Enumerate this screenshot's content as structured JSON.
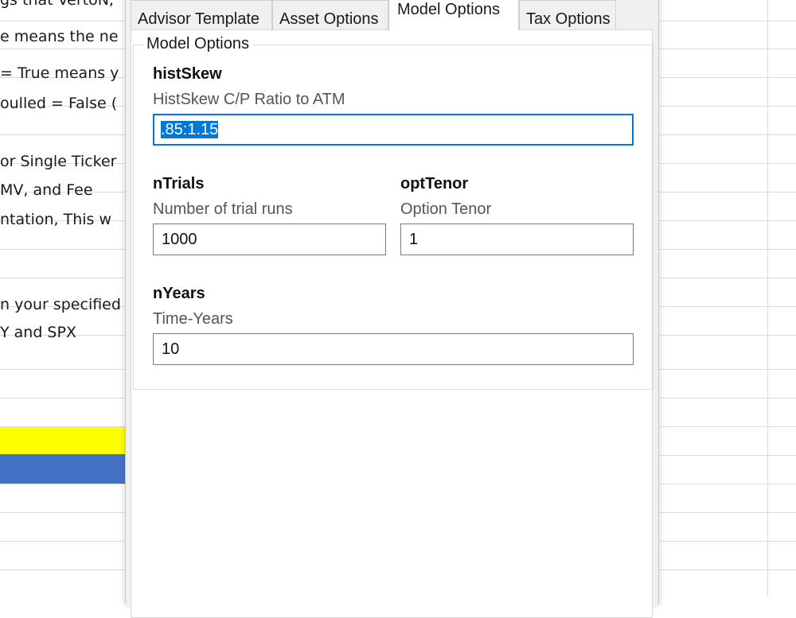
{
  "sheet": {
    "cell_texts": [
      "gs that VertoN,",
      "e means the ne",
      "= True means y",
      "oulled = False  (",
      "or Single Ticker",
      "MV, and Fee",
      "ntation, This w",
      "n your specified",
      "Y and SPX"
    ],
    "colors": {
      "yellow_fill": "#ffff00",
      "blue_fill": "#4472c4"
    }
  },
  "dialog": {
    "tabs": [
      {
        "label": "Advisor Template",
        "active": false
      },
      {
        "label": "Asset Options",
        "active": false
      },
      {
        "label": "Model Options",
        "active": true
      },
      {
        "label": "Tax Options",
        "active": false
      }
    ],
    "group": {
      "legend": "Model Options",
      "fields": {
        "histSkew": {
          "name": "histSkew",
          "description": "HistSkew C/P Ratio to ATM",
          "value": ".85:1.15",
          "focused": true,
          "selected": true
        },
        "nTrials": {
          "name": "nTrials",
          "description": "Number of trial runs",
          "value": "1000"
        },
        "optTenor": {
          "name": "optTenor",
          "description": "Option Tenor",
          "value": "1"
        },
        "nYears": {
          "name": "nYears",
          "description": "Time-Years",
          "value": "10"
        }
      }
    },
    "colors": {
      "focus_border": "#0078d7",
      "selection": "#0078d7"
    }
  }
}
